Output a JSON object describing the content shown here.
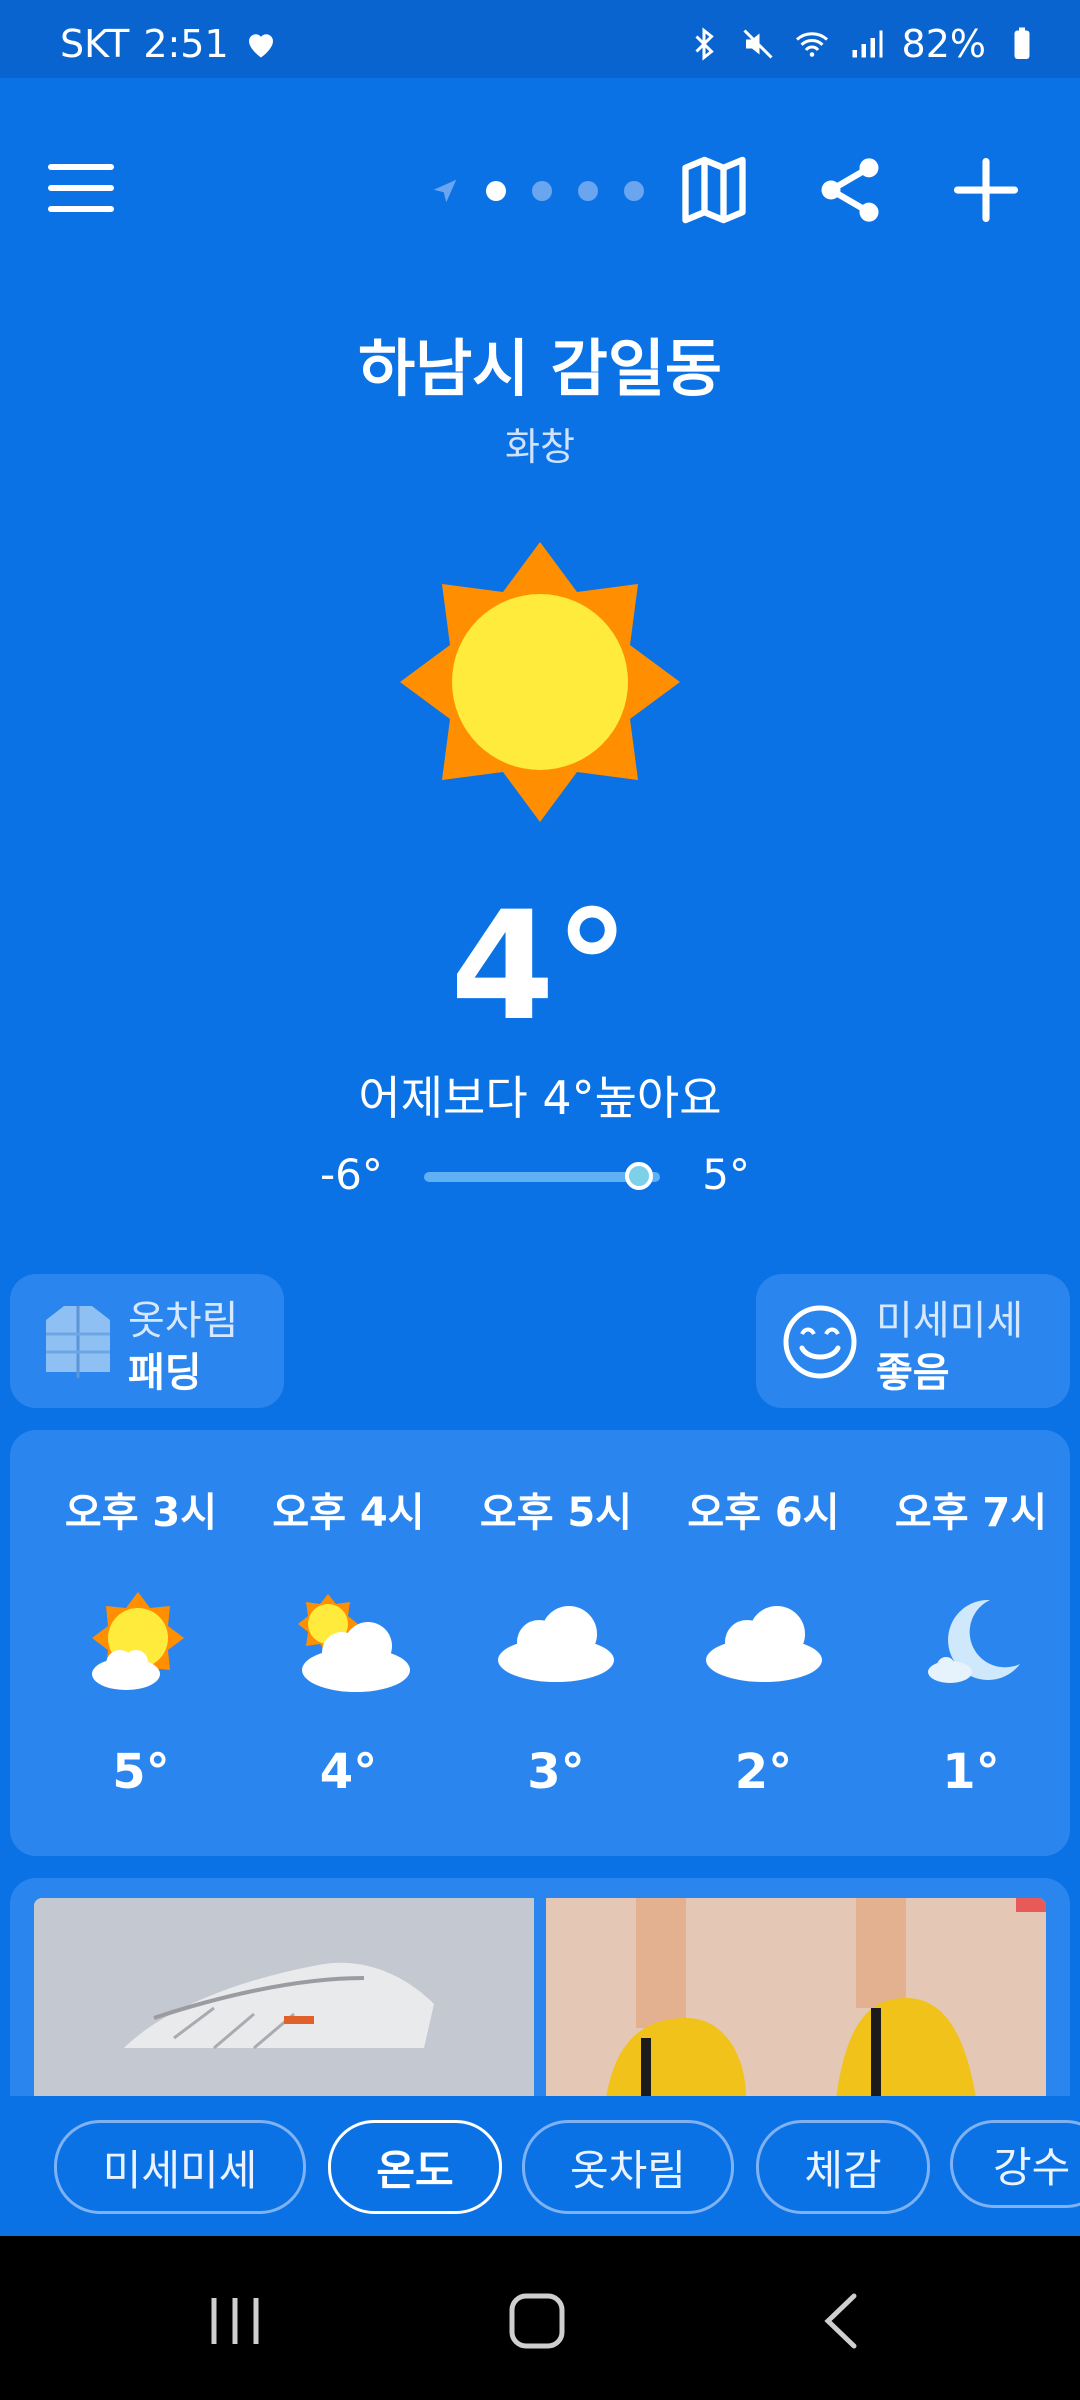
{
  "status_bar": {
    "carrier": "SKT",
    "time": "2:51",
    "battery": "82%"
  },
  "top_bar": {
    "menu_icon": "hamburger-icon",
    "page_count": 5,
    "active_page": 1
  },
  "location": {
    "city": "하남시 감일동",
    "condition": "화창"
  },
  "current": {
    "temperature": "4°",
    "compare_text": "어제보다 4°높아요",
    "min": "-6°",
    "max": "5°",
    "current_position_fraction": 0.91
  },
  "outfit": {
    "title": "옷차림",
    "value": "패딩"
  },
  "dust": {
    "title": "미세미세",
    "value": "좋음"
  },
  "hourly": [
    {
      "time": "오후 3시",
      "icon": "sun-cloud-icon",
      "temp": "5°"
    },
    {
      "time": "오후 4시",
      "icon": "cloud-sun-icon",
      "temp": "4°"
    },
    {
      "time": "오후 5시",
      "icon": "cloud-icon",
      "temp": "3°"
    },
    {
      "time": "오후 6시",
      "icon": "cloud-icon",
      "temp": "2°"
    },
    {
      "time": "오후 7시",
      "icon": "moon-icon",
      "temp": "1°"
    }
  ],
  "tabs": [
    {
      "label": "미세미세",
      "active": false
    },
    {
      "label": "온도",
      "active": true
    },
    {
      "label": "옷차림",
      "active": false
    },
    {
      "label": "체감",
      "active": false
    },
    {
      "label": "강수",
      "active": false
    }
  ],
  "colors": {
    "background": "#0b72e6",
    "card": "#2a86ee",
    "sun_orange": "#ff8f00",
    "sun_yellow": "#ffeb3b"
  }
}
